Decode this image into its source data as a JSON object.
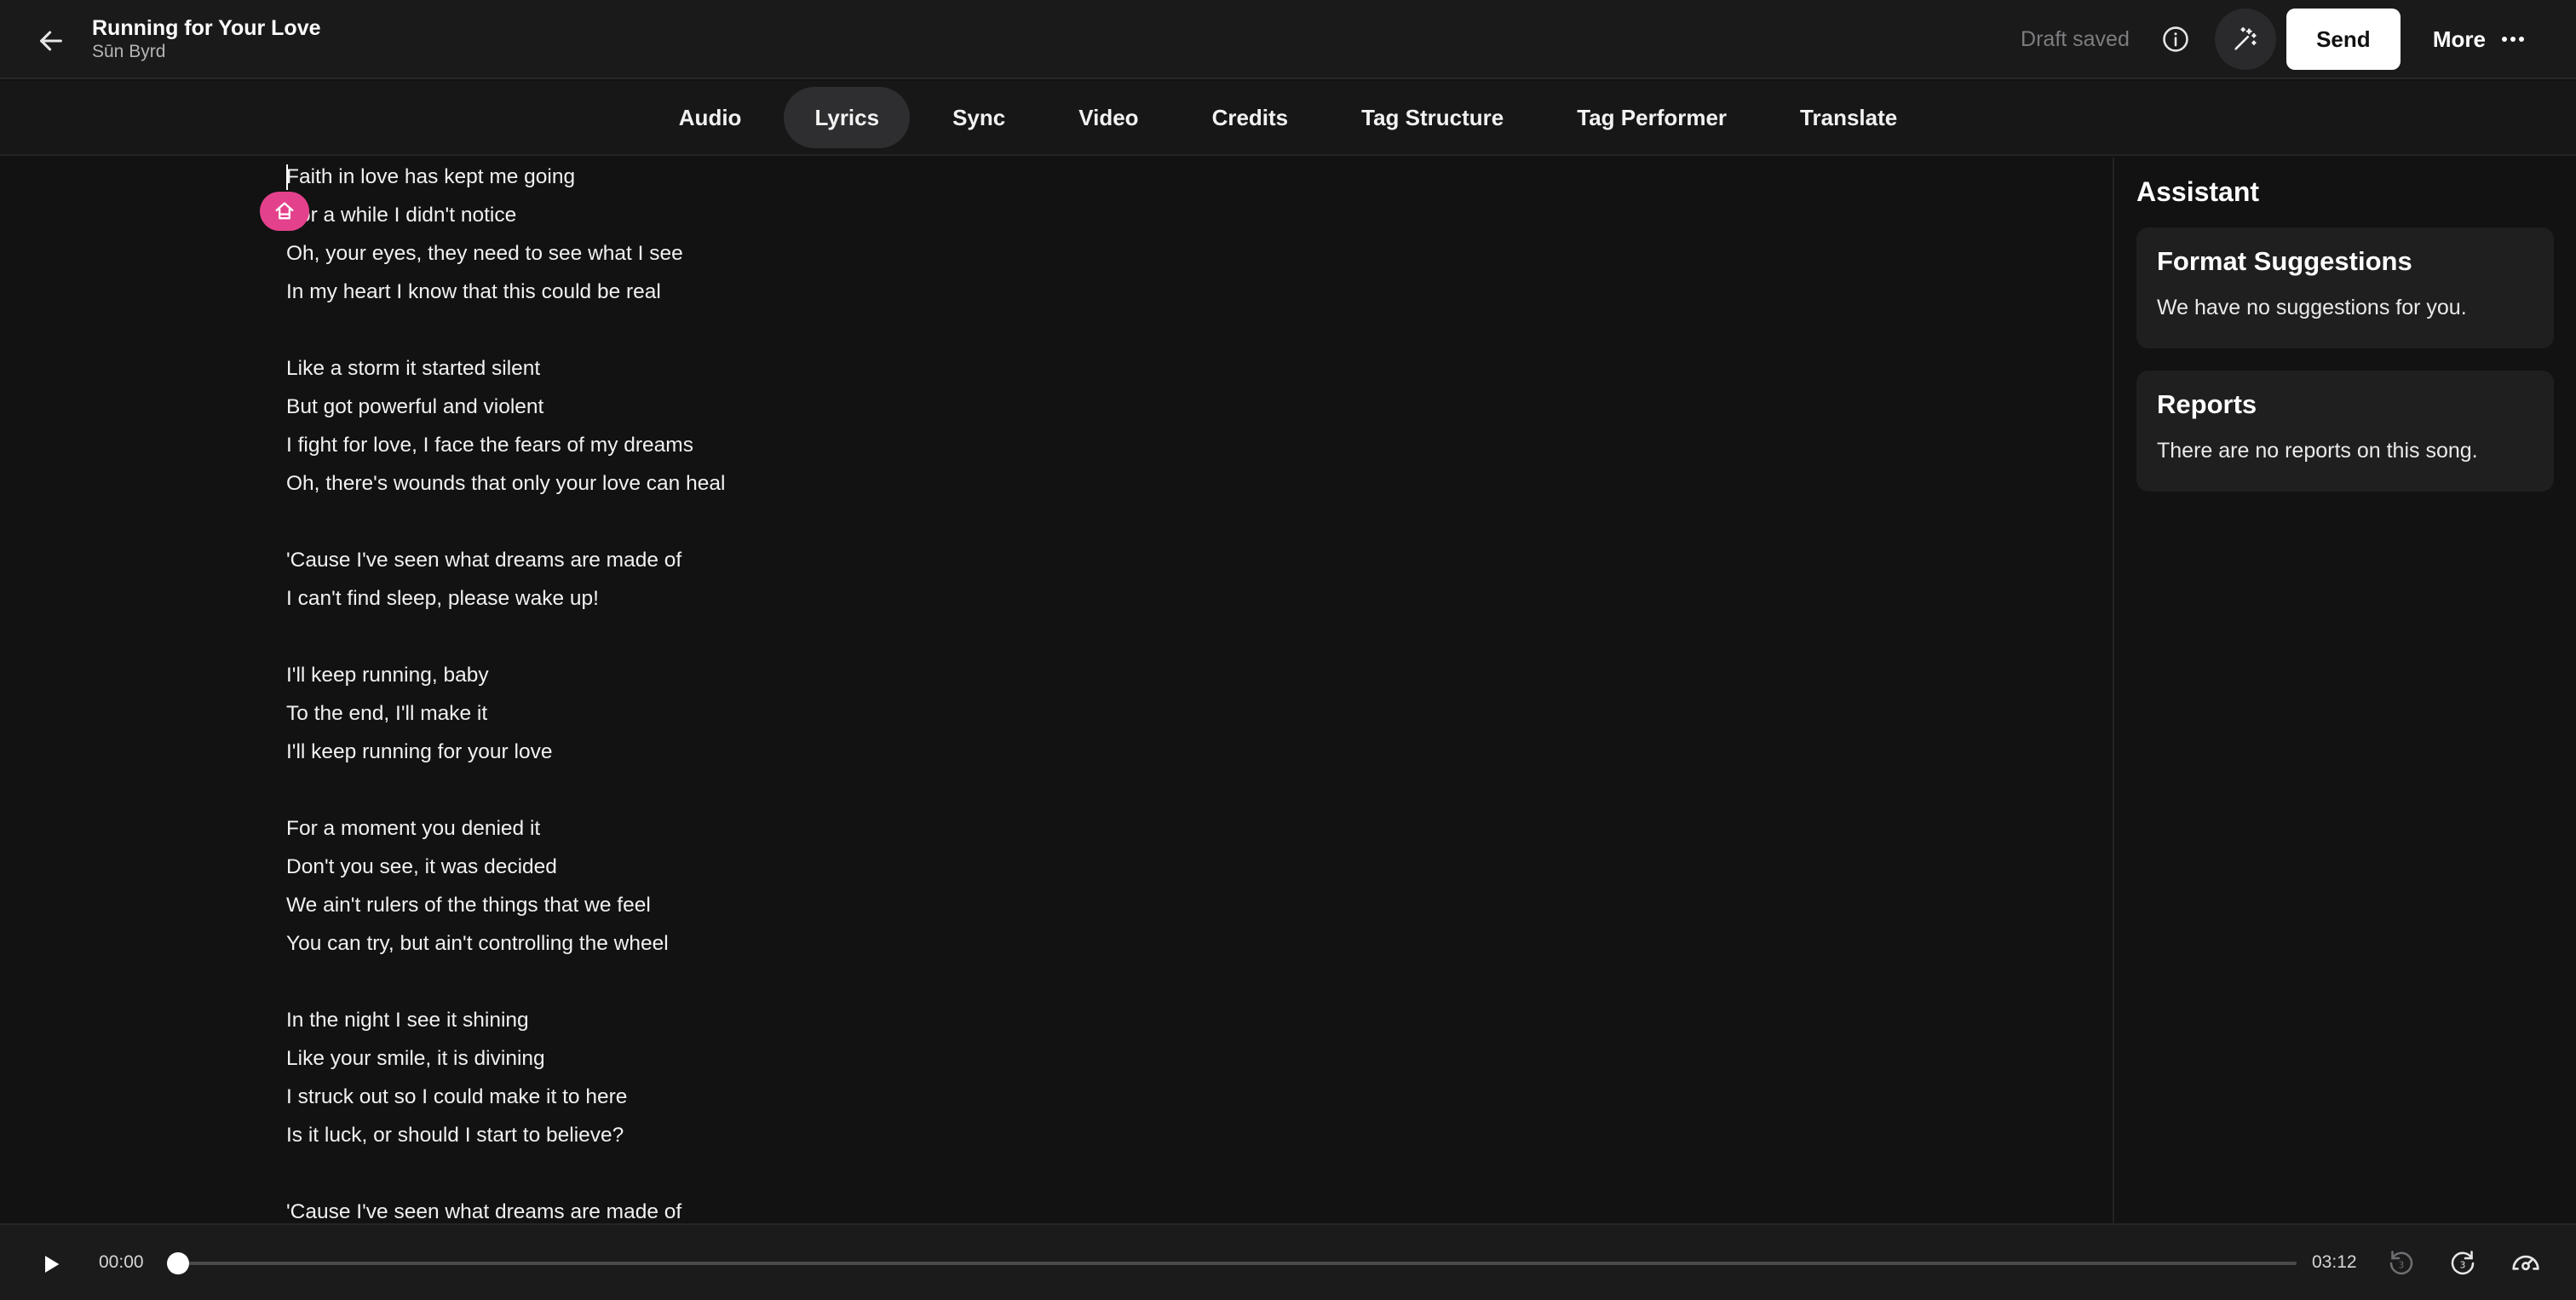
{
  "header": {
    "title": "Running for Your Love",
    "artist": "Sūn Byrd",
    "draft_status": "Draft saved",
    "send_label": "Send",
    "more_label": "More"
  },
  "tabs": [
    {
      "label": "Audio",
      "active": false
    },
    {
      "label": "Lyrics",
      "active": true
    },
    {
      "label": "Sync",
      "active": false
    },
    {
      "label": "Video",
      "active": false
    },
    {
      "label": "Credits",
      "active": false
    },
    {
      "label": "Tag Structure",
      "active": false
    },
    {
      "label": "Tag Performer",
      "active": false
    },
    {
      "label": "Translate",
      "active": false
    }
  ],
  "lyrics": {
    "lines": [
      "Faith in love has kept me going",
      "For a while I didn't notice",
      "Oh, your eyes, they need to see what I see",
      "In my heart I know that this could be real",
      "",
      "Like a storm it started silent",
      "But got powerful and violent",
      "I fight for love, I face the fears of my dreams",
      "Oh, there's wounds that only your love can heal",
      "",
      "'Cause I've seen what dreams are made of",
      "I can't find sleep, please wake up!",
      "",
      "I'll keep running, baby",
      "To the end, I'll make it",
      "I'll keep running for your love",
      "",
      "For a moment you denied it",
      "Don't you see, it was decided",
      "We ain't rulers of the things that we feel",
      "You can try, but ain't controlling the wheel",
      "",
      "In the night I see it shining",
      "Like your smile, it is divining",
      "I struck out so I could make it to here",
      "Is it luck, or should I start to believe?",
      "",
      "'Cause I've seen what dreams are made of"
    ]
  },
  "assistant": {
    "title": "Assistant",
    "cards": [
      {
        "title": "Format Suggestions",
        "text": "We have no suggestions for you."
      },
      {
        "title": "Reports",
        "text": "There are no reports on this song."
      }
    ]
  },
  "player": {
    "current_time": "00:00",
    "total_time": "03:12",
    "progress": 0.0
  },
  "colors": {
    "background": "#121213",
    "accent_pink": "#e4418c",
    "send_button": "#ffffff"
  },
  "icons": {
    "back": "arrow-left-icon",
    "info": "info-circle-icon",
    "magic": "magic-wand-icon",
    "more": "ellipsis-icon",
    "play": "play-icon",
    "tag": "tag-section-icon",
    "rewind": "rewind-3s-icon",
    "forward": "forward-3s-icon",
    "speed": "playback-speed-icon"
  }
}
